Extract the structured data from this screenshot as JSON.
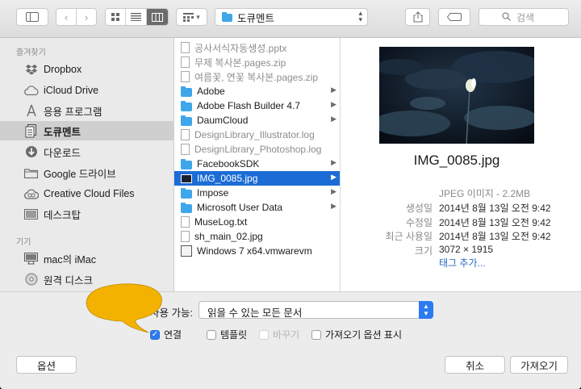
{
  "toolbar": {
    "location": "도큐멘트",
    "search_placeholder": "검색"
  },
  "sidebar": {
    "favorites_header": "즐겨찾기",
    "devices_header": "기기",
    "items": [
      {
        "label": "Dropbox",
        "icon": "dropbox-icon"
      },
      {
        "label": "iCloud Drive",
        "icon": "cloud-icon"
      },
      {
        "label": "응용 프로그램",
        "icon": "applications-icon"
      },
      {
        "label": "도큐멘트",
        "icon": "documents-icon",
        "selected": true
      },
      {
        "label": "다운로드",
        "icon": "download-icon"
      },
      {
        "label": "Google 드라이브",
        "icon": "folder-icon"
      },
      {
        "label": "Creative Cloud Files",
        "icon": "creative-cloud-icon"
      },
      {
        "label": "데스크탑",
        "icon": "desktop-icon"
      }
    ],
    "devices": [
      {
        "label": "mac의 iMac",
        "icon": "imac-icon"
      },
      {
        "label": "원격 디스크",
        "icon": "disc-icon"
      }
    ]
  },
  "files": [
    {
      "name": "공사서식자동생성.pptx",
      "kind": "doc",
      "dim": true
    },
    {
      "name": "무제 복사본.pages.zip",
      "kind": "doc",
      "dim": true
    },
    {
      "name": "여름꽃, 연꽃 복사본.pages.zip",
      "kind": "doc",
      "dim": true
    },
    {
      "name": "Adobe",
      "kind": "folder",
      "arrow": true
    },
    {
      "name": "Adobe Flash Builder 4.7",
      "kind": "folder",
      "arrow": true
    },
    {
      "name": "DaumCloud",
      "kind": "folder",
      "arrow": true
    },
    {
      "name": "DesignLibrary_Illustrator.log",
      "kind": "doc",
      "dim": true
    },
    {
      "name": "DesignLibrary_Photoshop.log",
      "kind": "doc",
      "dim": true
    },
    {
      "name": "FacebookSDK",
      "kind": "folder",
      "arrow": true
    },
    {
      "name": "IMG_0085.jpg",
      "kind": "image",
      "selected": true,
      "arrow": true
    },
    {
      "name": "Impose",
      "kind": "folder",
      "arrow": true
    },
    {
      "name": "Microsoft User Data",
      "kind": "folder",
      "arrow": true
    },
    {
      "name": "MuseLog.txt",
      "kind": "doc"
    },
    {
      "name": "sh_main_02.jpg",
      "kind": "doc"
    },
    {
      "name": "Windows 7 x64.vmwarevm",
      "kind": "vm"
    }
  ],
  "preview": {
    "filename": "IMG_0085.jpg",
    "type_size": "JPEG 이미지 - 2.2MB",
    "rows": [
      {
        "key": "생성일",
        "value": "2014년 8월 13일 오전 9:42"
      },
      {
        "key": "수정일",
        "value": "2014년 8월 13일 오전 9:42"
      },
      {
        "key": "최근 사용일",
        "value": "2014년 8월 13일 오전 9:42"
      },
      {
        "key": "크기",
        "value": "3072 × 1915"
      }
    ],
    "tags_link": "태그 추가..."
  },
  "options": {
    "enable_label": "사용 가능:",
    "enable_value": "읽을 수 있는 모든 문서",
    "checkboxes": [
      {
        "label": "연결",
        "checked": true
      },
      {
        "label": "템플릿",
        "checked": false
      },
      {
        "label": "바꾸기",
        "checked": false,
        "disabled": true
      },
      {
        "label": "가져오기 옵션 표시",
        "checked": false
      }
    ]
  },
  "buttons": {
    "options": "옵션",
    "cancel": "취소",
    "import": "가져오기"
  },
  "colors": {
    "selection": "#1c6cd6",
    "folder": "#3fa6ec",
    "callout": "#f3b200"
  }
}
